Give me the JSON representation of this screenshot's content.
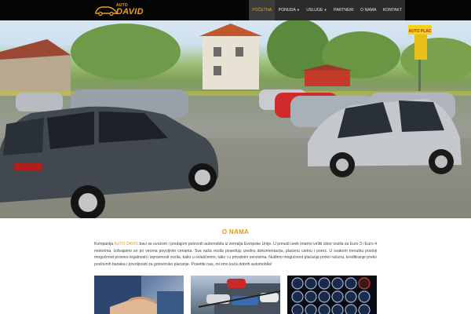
{
  "logo": {
    "small": "AUTO",
    "big": "DAVID"
  },
  "nav": {
    "items": [
      {
        "label": "POČETNA",
        "active": true
      },
      {
        "label": "PONUDA",
        "dropdown": true
      },
      {
        "label": "USLUGE",
        "dropdown": true
      },
      {
        "label": "PARTNERI"
      },
      {
        "label": "O NAMA"
      },
      {
        "label": "KONTAKT"
      }
    ]
  },
  "hero": {
    "sign": "AUTO PLAC"
  },
  "about": {
    "title": "O NAMA",
    "text_before": "Kompanija ",
    "brand": "AUTO DAVID",
    "text_after": " bavi se uvozom i prodajom polovnih automobila iz zemalja Evropske Unije. U ponudi uvek imamo veliki izbor vozila sa Euro 3 i Euro 4 motorima. Izdvajamo se po veoma povoljnim cenama. Sva naša vozila poseduju urednu dokumentaciju, plaćenu carinu i porez. U svakom trenutku postoji mogućnost provere legalnosti i ispravnosti vozila, kako u ovlašćenim, tako i u privatnim servisima. Nudimo mogućnost plaćanja preko računa, kreditiranje preko poslovnih banaka i povoljnosti za gotovinsko plaćanje. Posetite nas, mi smo kuća dobrih automobila!"
  },
  "thumbnails": [
    {
      "icon": "handshake-image"
    },
    {
      "icon": "car-transporter-image"
    },
    {
      "icon": "car-brand-logos-image"
    }
  ],
  "colors": {
    "accent": "#f0a010",
    "header_bg": "#050505",
    "nav_bg": "#2b2b2b"
  }
}
